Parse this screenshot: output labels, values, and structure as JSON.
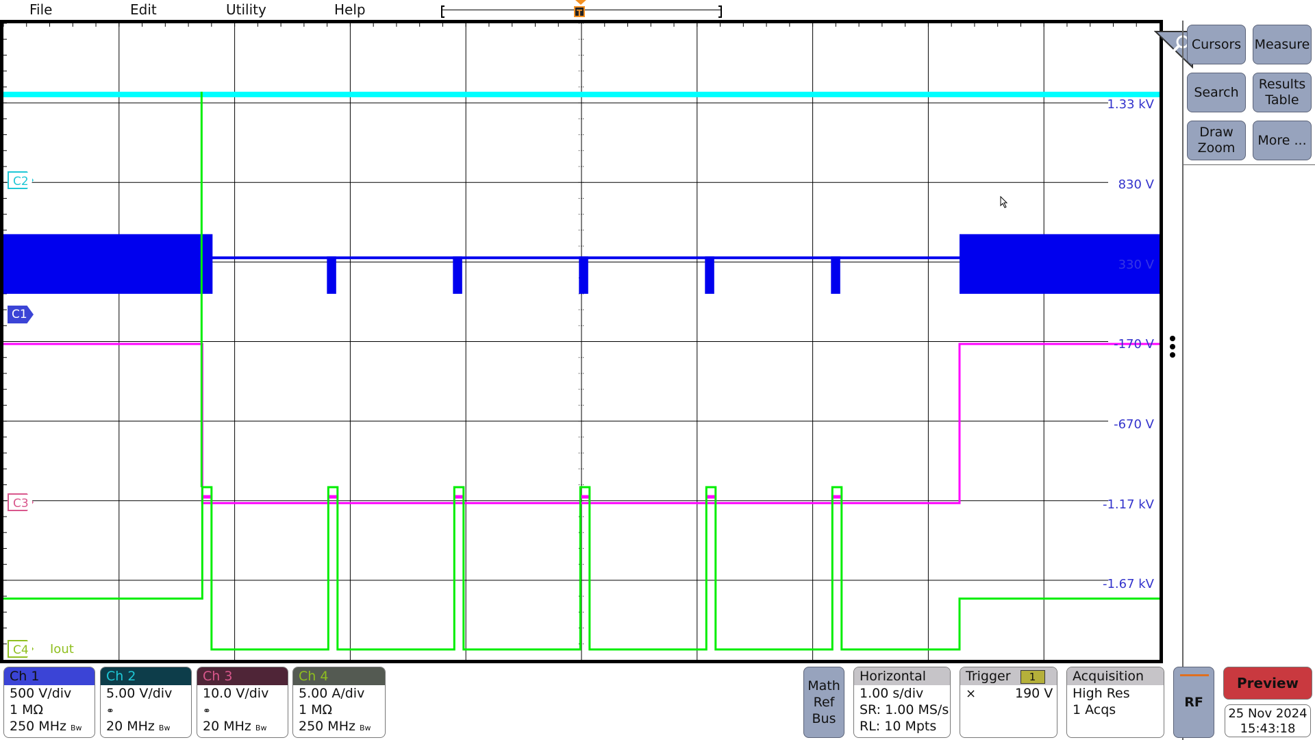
{
  "menu": {
    "items": [
      "File",
      "Edit",
      "Utility",
      "Help"
    ]
  },
  "horizontal_position": {
    "trigger_marker_label": "T",
    "record_view_fraction": [
      0.0,
      1.0
    ]
  },
  "plot": {
    "divisions": {
      "horizontal": 10,
      "vertical": 8
    },
    "scale_labels": [
      "1.33 kV",
      "830 V",
      "330 V",
      "-170 V",
      "-670 V",
      "-1.17 kV",
      "-1.67 kV"
    ],
    "channel_markers": [
      {
        "id": "C2",
        "label": "C2",
        "color": "#1ec7d6"
      },
      {
        "id": "C1",
        "label": "C1",
        "color": "#3b44d6"
      },
      {
        "id": "C3",
        "label": "C3",
        "color": "#d9578c"
      },
      {
        "id": "C4",
        "label": "C4",
        "color": "#8fbf1f",
        "name": "Iout"
      }
    ],
    "trace_colors": {
      "ch1": "#0000ee",
      "ch2": "#00ffff",
      "ch3": "#ff00ff",
      "ch4": "#00ee00"
    },
    "pulses_time_div": [
      1.72,
      2.81,
      3.9,
      4.99,
      6.08,
      7.17
    ],
    "pulse_width_div": 0.08,
    "burst_window_div": [
      1.72,
      8.27
    ]
  },
  "side_panel": {
    "buttons": [
      {
        "id": "cursors",
        "label": "Cursors"
      },
      {
        "id": "measure",
        "label": "Measure"
      },
      {
        "id": "search",
        "label": "Search"
      },
      {
        "id": "results-table",
        "label": "Results\nTable"
      },
      {
        "id": "draw-zoom",
        "label": "Draw\nZoom"
      },
      {
        "id": "more",
        "label": "More ..."
      }
    ]
  },
  "channels": [
    {
      "name": "Ch 1",
      "scale": "500 V/div",
      "coupling": "1 MΩ",
      "bandwidth": "250 MHz",
      "hdr_bg": "#3b44d6",
      "hdr_fg": "#111111",
      "probe_icon": false
    },
    {
      "name": "Ch 2",
      "scale": "5.00 V/div",
      "coupling": "",
      "bandwidth": "20 MHz",
      "hdr_bg": "#0d3d4a",
      "hdr_fg": "#1ec7d6",
      "probe_icon": true
    },
    {
      "name": "Ch 3",
      "scale": "10.0 V/div",
      "coupling": "",
      "bandwidth": "20 MHz",
      "hdr_bg": "#4f2537",
      "hdr_fg": "#d9578c",
      "probe_icon": true
    },
    {
      "name": "Ch 4",
      "scale": "5.00 A/div",
      "coupling": "1 MΩ",
      "bandwidth": "250 MHz",
      "hdr_bg": "#545a52",
      "hdr_fg": "#8fbf1f",
      "probe_icon": false
    }
  ],
  "bw_mark": "Bw",
  "math_ref_bus": {
    "label": "Math\nRef\nBus"
  },
  "horizontal": {
    "title": "Horizontal",
    "scale": "1.00 s/div",
    "sample_rate": "SR: 1.00 MS/s",
    "record_length": "RL: 10 Mpts"
  },
  "trigger": {
    "title": "Trigger",
    "source": "1",
    "slope_icon": "either-edge-icon",
    "level": "190 V"
  },
  "acquisition": {
    "title": "Acquisition",
    "mode": "High Res",
    "count": "1 Acqs"
  },
  "rf": {
    "label": "RF"
  },
  "preview": {
    "label": "Preview"
  },
  "datetime": {
    "date": "25 Nov 2024",
    "time": "15:43:18"
  }
}
